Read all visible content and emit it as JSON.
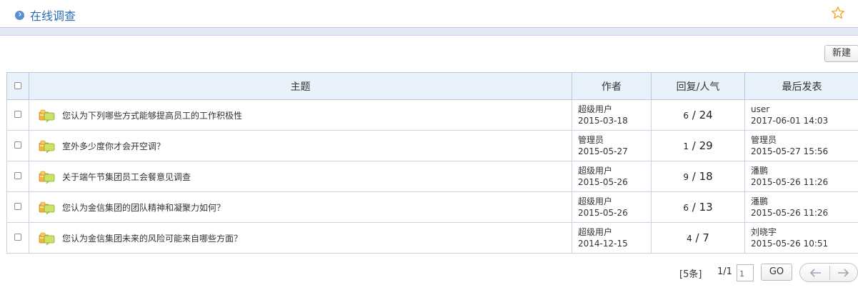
{
  "header": {
    "title": "在线调查",
    "accent": "#2d6bb5"
  },
  "toolbar": {
    "new_label": "新建"
  },
  "table": {
    "headers": {
      "topic": "主题",
      "author": "作者",
      "replies": "回复/人气",
      "last": "最后发表"
    },
    "rows": [
      {
        "topic": "您认为下列哪些方式能够提高员工的工作积极性",
        "author": "超级用户",
        "date": "2015-03-18",
        "replies": "6",
        "views": "24",
        "last_user": "user",
        "last_time": "2017-06-01 14:03"
      },
      {
        "topic": "室外多少度你才会开空调？",
        "author": "管理员",
        "date": "2015-05-27",
        "replies": "1",
        "views": "29",
        "last_user": "管理员",
        "last_time": "2015-05-27 15:56"
      },
      {
        "topic": "关于端午节集团员工会餐意见调查",
        "author": "超级用户",
        "date": "2015-05-26",
        "replies": "9",
        "views": "18",
        "last_user": "潘鹏",
        "last_time": "2015-05-26 11:26"
      },
      {
        "topic": "您认为金信集团的团队精神和凝聚力如何？",
        "author": "超级用户",
        "date": "2015-05-26",
        "replies": "6",
        "views": "13",
        "last_user": "潘鹏",
        "last_time": "2015-05-26 11:26"
      },
      {
        "topic": "您认为金信集团未来的风险可能来自哪些方面？",
        "author": "超级用户",
        "date": "2014-12-15",
        "replies": "4",
        "views": "7",
        "last_user": "刘晓宇",
        "last_time": "2015-05-26 10:51"
      }
    ]
  },
  "pager": {
    "count": "[5条]",
    "pages": "1/1",
    "page_input": "1",
    "go_label": "GO"
  }
}
